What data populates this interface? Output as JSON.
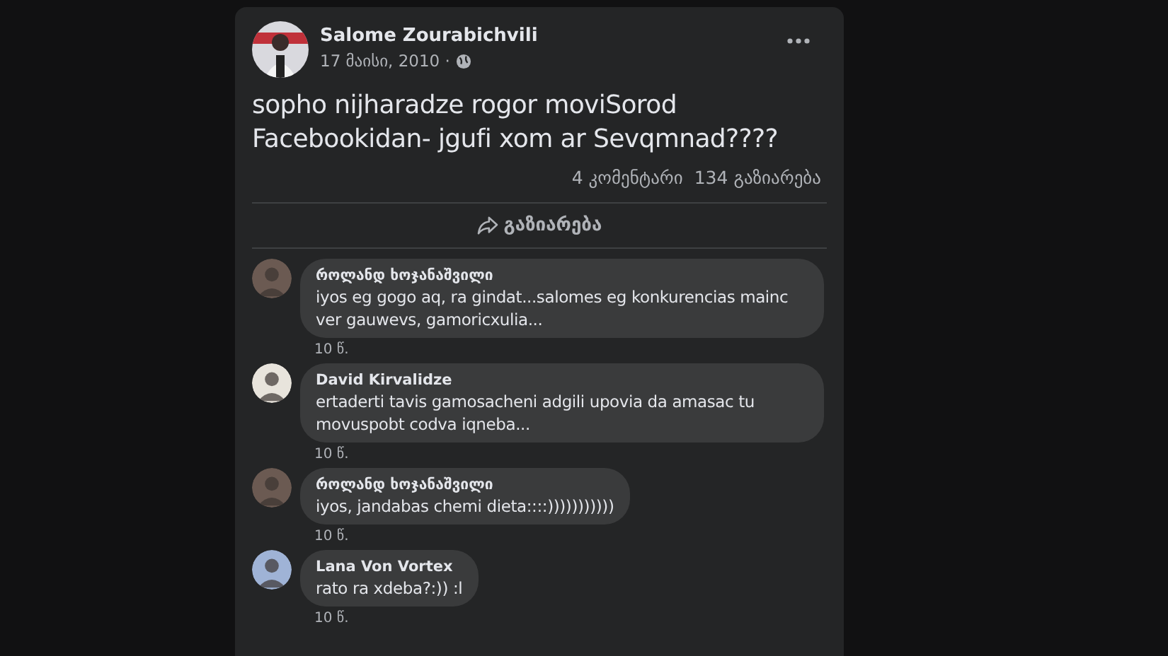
{
  "post": {
    "author": "Salome Zourabichvili",
    "date": "17 მაისი, 2010 ·",
    "text": "sopho nijharadze rogor moviSorod Facebookidan- jgufi xom ar Sevqmnad????",
    "comments_count": "4 კომენტარი",
    "shares_count": "134 გაზიარება",
    "share_button": "გაზიარება"
  },
  "comments": [
    {
      "author": "როლანდ ხოჯანაშვილი",
      "text": "iyos eg gogo aq, ra gindat...salomes eg konkurencias mainc ver gauwevs, gamoricxulia...",
      "time": "10 წ."
    },
    {
      "author": "David Kirvalidze",
      "text": "ertaderti tavis gamosacheni adgili upovia da amasac tu movuspobt codva iqneba...",
      "time": "10 წ."
    },
    {
      "author": "როლანდ ხოჯანაშვილი",
      "text": "iyos, jandabas chemi dieta::::)))))))))))",
      "time": "10 წ."
    },
    {
      "author": "Lana Von Vortex",
      "text": "rato ra xdeba?:)) :l",
      "time": "10 წ."
    }
  ]
}
